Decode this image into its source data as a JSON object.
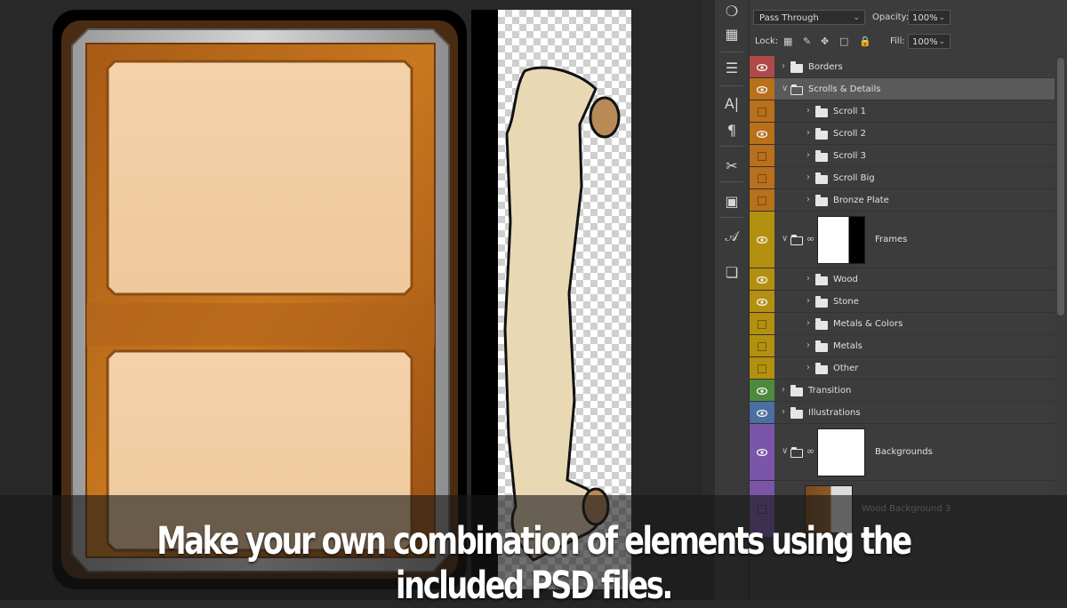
{
  "blend": {
    "mode": "Pass Through",
    "opacity_label": "Opacity:",
    "opacity": "100%",
    "fill_label": "Fill:",
    "fill": "100%",
    "lock_label": "Lock:"
  },
  "layers": [
    {
      "name": "Borders",
      "color": "#b04a4a",
      "visible": true,
      "indent": 0,
      "type": "folder",
      "open": false
    },
    {
      "name": "Scrolls & Details",
      "color": "#b8701c",
      "visible": true,
      "indent": 0,
      "type": "folder",
      "open": true,
      "selected": true
    },
    {
      "name": "Scroll 1",
      "color": "#b8701c",
      "visible": false,
      "indent": 1,
      "type": "folder",
      "open": false
    },
    {
      "name": "Scroll 2",
      "color": "#b8701c",
      "visible": true,
      "indent": 1,
      "type": "folder",
      "open": false
    },
    {
      "name": "Scroll 3",
      "color": "#b8701c",
      "visible": false,
      "indent": 1,
      "type": "folder",
      "open": false
    },
    {
      "name": "Scroll Big",
      "color": "#b8701c",
      "visible": false,
      "indent": 1,
      "type": "folder",
      "open": false
    },
    {
      "name": "Bronze Plate",
      "color": "#b8701c",
      "visible": false,
      "indent": 1,
      "type": "folder",
      "open": false
    },
    {
      "name": "Frames",
      "color": "#b3900f",
      "visible": true,
      "indent": 0,
      "type": "masked-folder",
      "open": true
    },
    {
      "name": "Wood",
      "color": "#b3900f",
      "visible": true,
      "indent": 1,
      "type": "folder",
      "open": false
    },
    {
      "name": "Stone",
      "color": "#b3900f",
      "visible": true,
      "indent": 1,
      "type": "folder",
      "open": false
    },
    {
      "name": "Metals & Colors",
      "color": "#b3900f",
      "visible": false,
      "indent": 1,
      "type": "folder",
      "open": false
    },
    {
      "name": "Metals",
      "color": "#b3900f",
      "visible": false,
      "indent": 1,
      "type": "folder",
      "open": false
    },
    {
      "name": "Other",
      "color": "#b3900f",
      "visible": false,
      "indent": 1,
      "type": "folder",
      "open": false
    },
    {
      "name": "Transition",
      "color": "#4f8a3c",
      "visible": true,
      "indent": 0,
      "type": "folder",
      "open": false
    },
    {
      "name": "Illustrations",
      "color": "#4a6fa0",
      "visible": true,
      "indent": 0,
      "type": "folder",
      "open": false
    },
    {
      "name": "Backgrounds",
      "color": "#7a55a8",
      "visible": true,
      "indent": 0,
      "type": "masked-folder",
      "open": true
    },
    {
      "name": "Wood Background 3",
      "color": "#7a55a8",
      "visible": false,
      "indent": 1,
      "type": "image-layer",
      "open": false
    }
  ],
  "tools": [
    "palette-icon",
    "grid-icon",
    "stamp-list-icon",
    "text-icon",
    "paragraph-icon",
    "scissors-icon",
    "frame-icon",
    "glyph-icon",
    "cubes-icon"
  ],
  "caption": "Make your own combination of elements using the included PSD files."
}
